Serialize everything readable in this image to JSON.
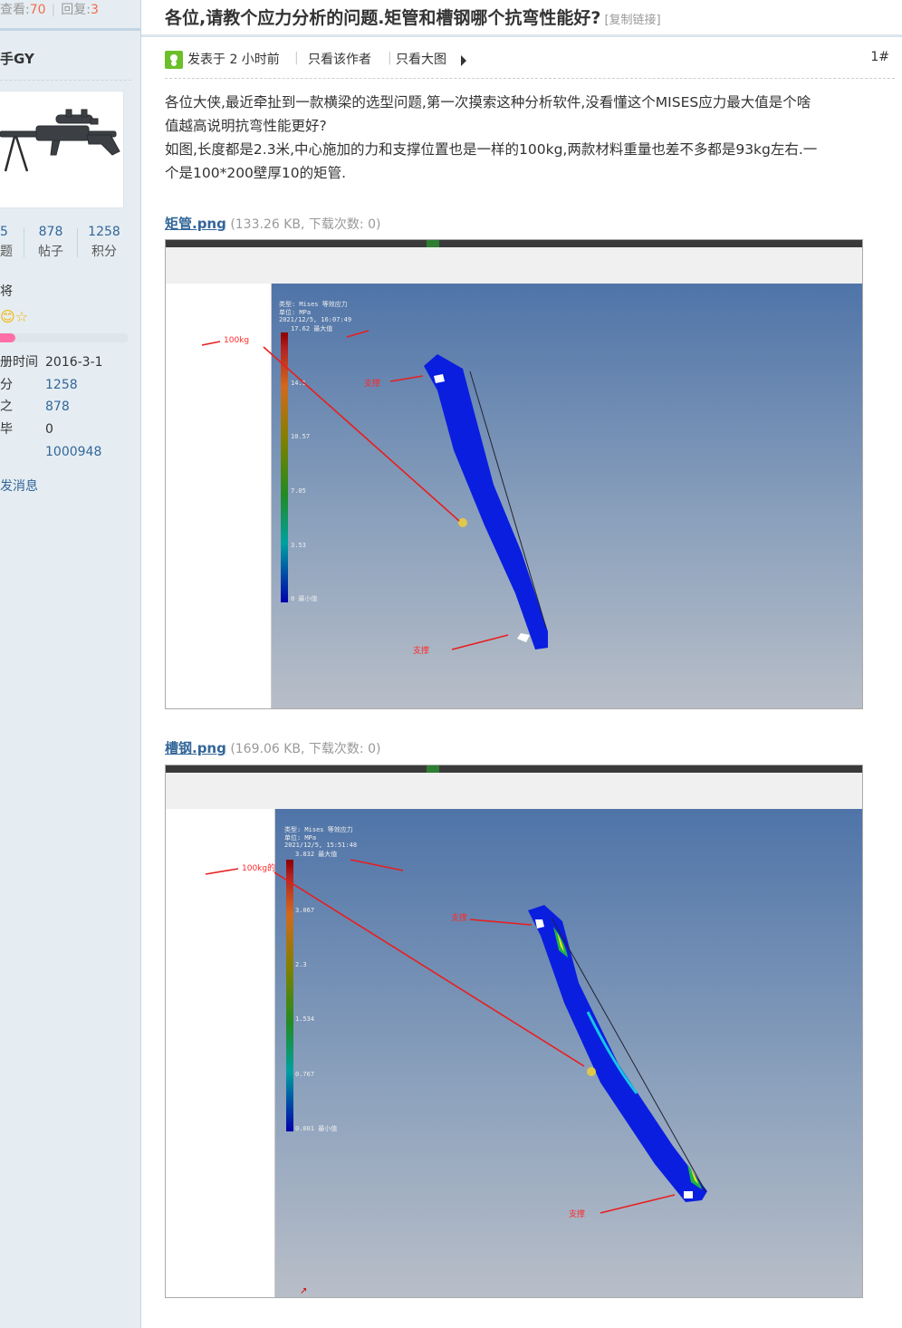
{
  "sidebar": {
    "views_label": "查看:",
    "views": "70",
    "replies_label": "回复:",
    "replies": "3",
    "username": "手GY",
    "stats": [
      {
        "num": "5",
        "label": "题"
      },
      {
        "num": "878",
        "label": "帖子"
      },
      {
        "num": "1258",
        "label": "积分"
      }
    ],
    "rank": "将",
    "info": [
      {
        "k": "册时间",
        "v": "2016-3-1"
      },
      {
        "k": "分",
        "v": "1258"
      },
      {
        "k": "之",
        "v": "878"
      },
      {
        "k": "毕",
        "v": "0"
      },
      {
        "k": "",
        "v": "1000948"
      }
    ],
    "send_message": "发消息",
    "progress": 0.12
  },
  "thread": {
    "title": "各位,请教个应力分析的问题.矩管和槽钢哪个抗弯性能好?",
    "copy_link": "[复制链接]",
    "posted": "发表于 2 小时前",
    "only_author": "只看该作者",
    "big_image": "只看大图",
    "floor": "1#",
    "body_lines": [
      "各位大侠,最近牵扯到一款横梁的选型问题,第一次摸索这种分析软件,没看懂这个MISES应力最大值是个啥",
      "值越高说明抗弯性能更好?",
      "  如图,长度都是2.3米,中心施加的力和支撑位置也是一样的100kg,两款材料重量也差不多都是93kg左右.一",
      "个是100*200壁厚10的矩管."
    ]
  },
  "attachments": [
    {
      "name": "矩管.png",
      "info": "(133.26 KB, 下载次数: 0)",
      "viewer": {
        "header": [
          "类型: Mises 等效应力",
          "单位: MPa",
          "2021/12/5, 16:07:49"
        ],
        "max": "17.62 最大值",
        "ticks": [
          "14.1",
          "10.57",
          "7.05",
          "3.53",
          "0 最小值"
        ],
        "load": "100kg",
        "support": "支撑"
      }
    },
    {
      "name": "槽钢.png",
      "info": "(169.06 KB, 下载次数: 0)",
      "viewer": {
        "header": [
          "类型: Mises 等效应力",
          "单位: MPa",
          "2021/12/5, 15:51:48"
        ],
        "max": "3.832 最大值",
        "ticks": [
          "3.067",
          "2.3",
          "1.534",
          "0.767",
          "0.001 最小值"
        ],
        "load": "100kg的",
        "support": "支撑"
      }
    }
  ]
}
